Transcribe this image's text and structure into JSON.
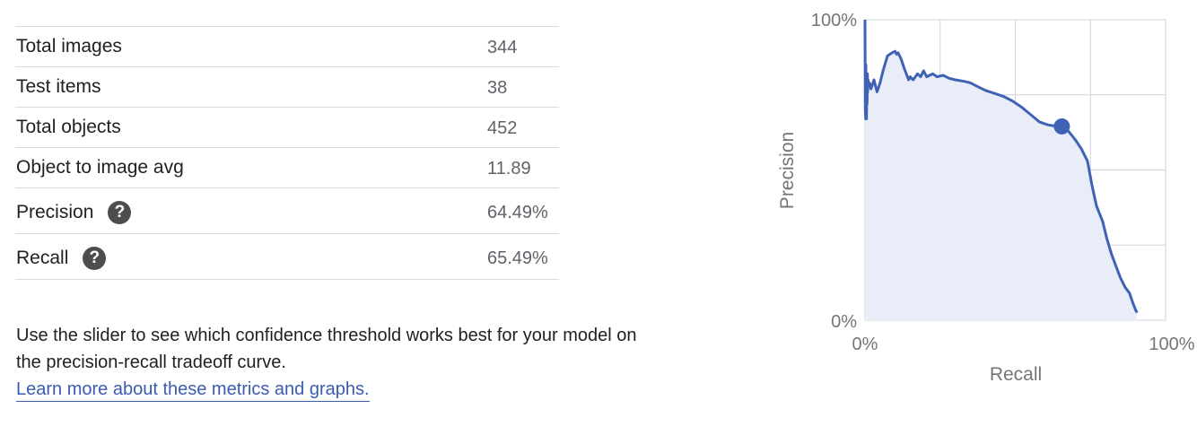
{
  "stats": [
    {
      "label": "Total images",
      "value": "344"
    },
    {
      "label": "Test items",
      "value": "38"
    },
    {
      "label": "Total objects",
      "value": "452"
    },
    {
      "label": "Object to image avg",
      "value": "11.89"
    },
    {
      "label": "Precision",
      "value": "64.49%",
      "help_icon": "help-icon"
    },
    {
      "label": "Recall",
      "value": "65.49%",
      "help_icon": "help-icon"
    }
  ],
  "help_glyph": "?",
  "description": {
    "text": "Use the slider to see which confidence threshold works best for your model on the precision-recall tradeoff curve.",
    "link_text": "Learn more about these metrics and graphs."
  },
  "colors": {
    "line": "#3f62b4",
    "fill": "#e8edf8",
    "grid": "#cfd2d8",
    "axis_text": "#757575"
  },
  "chart_data": {
    "type": "area",
    "xlabel": "Recall",
    "ylabel": "Precision",
    "xlim": [
      0,
      100
    ],
    "ylim": [
      0,
      100
    ],
    "x_ticks": [
      "0%",
      "100%"
    ],
    "y_ticks": [
      "0%",
      "100%"
    ],
    "grid": true,
    "series": [
      {
        "x": [
          0.0,
          0.1,
          0.2,
          0.3,
          0.4,
          0.5,
          0.6,
          0.7,
          0.8,
          0.9,
          1.0,
          1.3,
          1.5,
          2.0,
          3.0,
          4.0,
          5.0,
          6.0,
          7.5,
          9.0,
          10.0,
          10.5,
          11.0,
          12.0,
          13.0,
          14.5,
          15.0,
          16.0,
          17.5,
          18.5,
          19.5,
          20.5,
          21.5,
          22.5,
          24.0,
          26.0,
          28.0,
          30.0,
          33.0,
          35.0,
          38.0,
          40.0,
          43.0,
          46.0,
          49.0,
          52.0,
          55.0,
          58.0,
          61.0,
          64.0,
          65.5,
          66.5,
          68.0,
          70.0,
          72.0,
          74.0,
          75.5,
          77.0,
          79.0,
          80.5,
          82.0,
          83.5,
          85.0,
          86.5,
          88.0,
          89.0,
          90.0,
          90.5
        ],
        "y": [
          100.0,
          70.0,
          67.0,
          85.0,
          72.0,
          67.0,
          80.0,
          72.0,
          82.0,
          76.0,
          80.0,
          78.0,
          79.0,
          77.0,
          80.0,
          76.0,
          79.0,
          83.0,
          88.0,
          89.0,
          89.5,
          88.5,
          89.0,
          87.0,
          84.0,
          80.0,
          81.0,
          80.0,
          82.0,
          81.0,
          83.0,
          81.0,
          81.5,
          82.0,
          81.0,
          81.5,
          80.5,
          80.0,
          79.5,
          79.0,
          77.5,
          76.5,
          75.5,
          74.5,
          73.0,
          71.0,
          68.5,
          66.0,
          65.0,
          64.5,
          64.4,
          64.0,
          62.5,
          60.0,
          57.0,
          53.0,
          45.0,
          38.0,
          33.0,
          27.0,
          22.0,
          18.0,
          14.0,
          11.0,
          9.0,
          6.0,
          3.5,
          2.5
        ]
      }
    ],
    "selected_point": {
      "x": 65.49,
      "y": 64.49
    }
  }
}
